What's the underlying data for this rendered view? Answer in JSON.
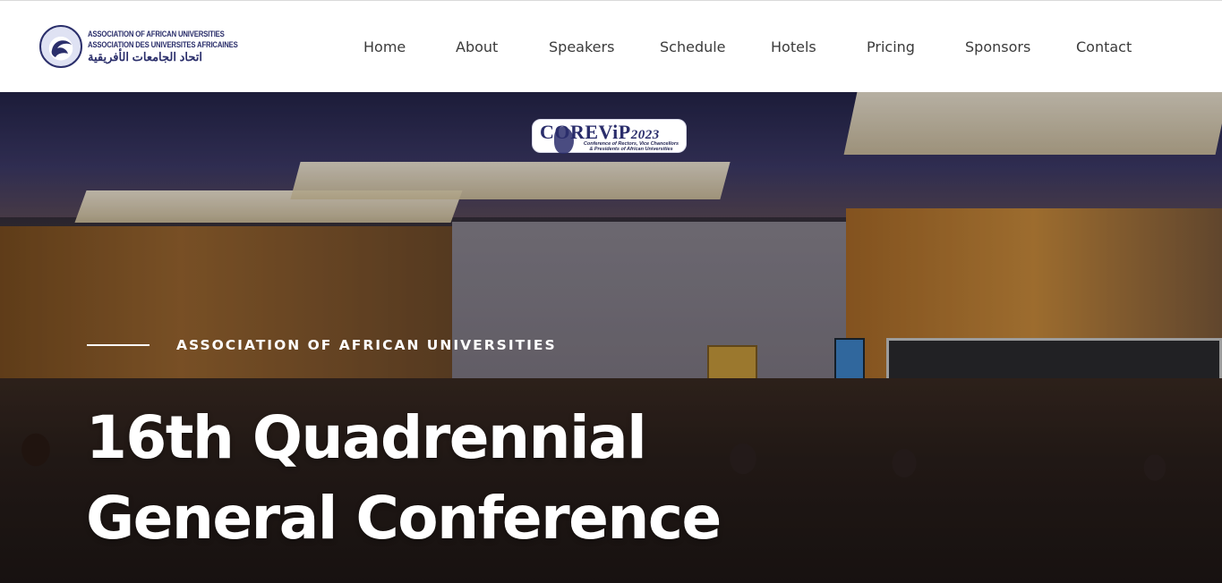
{
  "header": {
    "logo": {
      "line_en": "ASSOCIATION OF AFRICAN UNIVERSITIES",
      "line_fr": "ASSOCIATION DES UNIVERSITES AFRICAINES",
      "line_ar": "اتحاد الجامعات الأفريقية"
    },
    "nav": [
      {
        "label": "Home"
      },
      {
        "label": "About"
      },
      {
        "label": "Speakers"
      },
      {
        "label": "Schedule"
      },
      {
        "label": "Hotels"
      },
      {
        "label": "Pricing"
      },
      {
        "label": "Sponsors"
      },
      {
        "label": "Contact"
      }
    ]
  },
  "hero": {
    "event_logo": {
      "title": "COREViP",
      "year": "2023",
      "subtitle_line1": "Conference of Rectors, Vice Chancellors",
      "subtitle_line2": "& Presidents of African Universities"
    },
    "eyebrow": "ASSOCIATION OF AFRICAN UNIVERSITIES",
    "headline_line1": "16th Quadrennial",
    "headline_line2": "General Conference"
  },
  "colors": {
    "brand_navy": "#2b2f6b",
    "nav_text": "#3b3b3b",
    "hero_text": "#ffffff"
  }
}
